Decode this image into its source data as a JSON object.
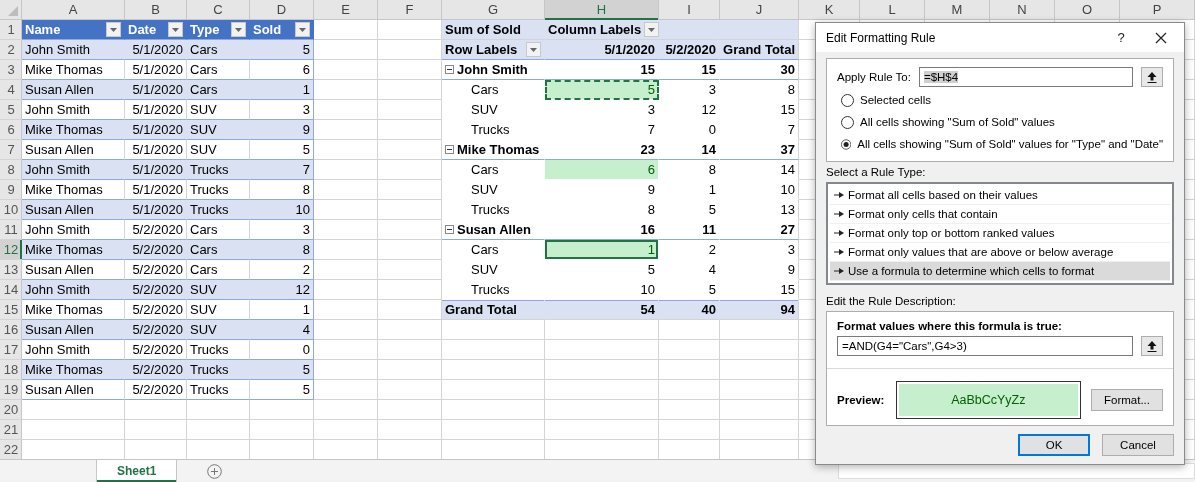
{
  "column_headers": [
    {
      "label": "A",
      "selected": false
    },
    {
      "label": "B",
      "selected": false
    },
    {
      "label": "C",
      "selected": false
    },
    {
      "label": "D",
      "selected": false
    },
    {
      "label": "E",
      "selected": false
    },
    {
      "label": "F",
      "selected": false
    },
    {
      "label": "G",
      "selected": false
    },
    {
      "label": "H",
      "selected": true
    },
    {
      "label": "I",
      "selected": false
    },
    {
      "label": "J",
      "selected": false
    },
    {
      "label": "K",
      "selected": false
    },
    {
      "label": "L",
      "selected": false
    },
    {
      "label": "M",
      "selected": false
    },
    {
      "label": "N",
      "selected": false
    },
    {
      "label": "O",
      "selected": false
    },
    {
      "label": "P",
      "selected": false
    }
  ],
  "row_headers": [
    {
      "label": "1",
      "selected": false
    },
    {
      "label": "2",
      "selected": false
    },
    {
      "label": "3",
      "selected": false
    },
    {
      "label": "4",
      "selected": false
    },
    {
      "label": "5",
      "selected": false
    },
    {
      "label": "6",
      "selected": false
    },
    {
      "label": "7",
      "selected": false
    },
    {
      "label": "8",
      "selected": false
    },
    {
      "label": "9",
      "selected": false
    },
    {
      "label": "10",
      "selected": false
    },
    {
      "label": "11",
      "selected": false
    },
    {
      "label": "12",
      "selected": true
    },
    {
      "label": "13",
      "selected": false
    },
    {
      "label": "14",
      "selected": false
    },
    {
      "label": "15",
      "selected": false
    },
    {
      "label": "16",
      "selected": false
    },
    {
      "label": "17",
      "selected": false
    },
    {
      "label": "18",
      "selected": false
    },
    {
      "label": "19",
      "selected": false
    },
    {
      "label": "20",
      "selected": false
    },
    {
      "label": "21",
      "selected": false
    },
    {
      "label": "22",
      "selected": false
    }
  ],
  "table": {
    "columns": [
      {
        "label": "Name"
      },
      {
        "label": "Date"
      },
      {
        "label": "Type"
      },
      {
        "label": "Sold"
      }
    ],
    "rows": [
      [
        "John Smith",
        "5/1/2020",
        "Cars",
        "5"
      ],
      [
        "Mike Thomas",
        "5/1/2020",
        "Cars",
        "6"
      ],
      [
        "Susan Allen",
        "5/1/2020",
        "Cars",
        "1"
      ],
      [
        "John Smith",
        "5/1/2020",
        "SUV",
        "3"
      ],
      [
        "Mike Thomas",
        "5/1/2020",
        "SUV",
        "9"
      ],
      [
        "Susan Allen",
        "5/1/2020",
        "SUV",
        "5"
      ],
      [
        "John Smith",
        "5/1/2020",
        "Trucks",
        "7"
      ],
      [
        "Mike Thomas",
        "5/1/2020",
        "Trucks",
        "8"
      ],
      [
        "Susan Allen",
        "5/1/2020",
        "Trucks",
        "10"
      ],
      [
        "John Smith",
        "5/2/2020",
        "Cars",
        "3"
      ],
      [
        "Mike Thomas",
        "5/2/2020",
        "Cars",
        "8"
      ],
      [
        "Susan Allen",
        "5/2/2020",
        "Cars",
        "2"
      ],
      [
        "John Smith",
        "5/2/2020",
        "SUV",
        "12"
      ],
      [
        "Mike Thomas",
        "5/2/2020",
        "SUV",
        "1"
      ],
      [
        "Susan Allen",
        "5/2/2020",
        "SUV",
        "4"
      ],
      [
        "John Smith",
        "5/2/2020",
        "Trucks",
        "0"
      ],
      [
        "Mike Thomas",
        "5/2/2020",
        "Trucks",
        "5"
      ],
      [
        "Susan Allen",
        "5/2/2020",
        "Trucks",
        "5"
      ]
    ]
  },
  "pivot": {
    "corner": "Sum of Sold",
    "column_field": "Column Labels",
    "row_field": "Row Labels",
    "columns": [
      "5/1/2020",
      "5/2/2020",
      "Grand Total"
    ],
    "groups": [
      {
        "label": "John Smith",
        "expanded": true,
        "values": [
          "15",
          "15",
          "30"
        ],
        "children": [
          {
            "label": "Cars",
            "values": [
              "5",
              "3",
              "8"
            ],
            "highlight": true,
            "copied": true,
            "selected": false
          },
          {
            "label": "SUV",
            "values": [
              "3",
              "12",
              "15"
            ],
            "highlight": false,
            "copied": false,
            "selected": false
          },
          {
            "label": "Trucks",
            "values": [
              "7",
              "0",
              "7"
            ],
            "highlight": false,
            "copied": false,
            "selected": false
          }
        ]
      },
      {
        "label": "Mike Thomas",
        "expanded": true,
        "values": [
          "23",
          "14",
          "37"
        ],
        "children": [
          {
            "label": "Cars",
            "values": [
              "6",
              "8",
              "14"
            ],
            "highlight": true,
            "copied": false,
            "selected": false
          },
          {
            "label": "SUV",
            "values": [
              "9",
              "1",
              "10"
            ],
            "highlight": false,
            "copied": false,
            "selected": false
          },
          {
            "label": "Trucks",
            "values": [
              "8",
              "5",
              "13"
            ],
            "highlight": false,
            "copied": false,
            "selected": false
          }
        ]
      },
      {
        "label": "Susan Allen",
        "expanded": true,
        "values": [
          "16",
          "11",
          "27"
        ],
        "children": [
          {
            "label": "Cars",
            "values": [
              "1",
              "2",
              "3"
            ],
            "highlight": true,
            "copied": false,
            "selected": true
          },
          {
            "label": "SUV",
            "values": [
              "5",
              "4",
              "9"
            ],
            "highlight": false,
            "copied": false,
            "selected": false
          },
          {
            "label": "Trucks",
            "values": [
              "10",
              "5",
              "15"
            ],
            "highlight": false,
            "copied": false,
            "selected": false
          }
        ]
      }
    ],
    "grand_total": {
      "label": "Grand Total",
      "values": [
        "54",
        "40",
        "94"
      ]
    }
  },
  "sheet_tabs": [
    {
      "label": "Sheet1",
      "selected": true
    }
  ],
  "dialog": {
    "title": "Edit Formatting Rule",
    "help": "?",
    "apply_label": "Apply Rule To:",
    "apply_value": "=$H$4",
    "scope_options": [
      {
        "label": "Selected cells",
        "selected": false
      },
      {
        "label": "All cells showing \"Sum of Sold\" values",
        "selected": false
      },
      {
        "label": "All cells showing \"Sum of Sold\" values for \"Type\" and \"Date\"",
        "selected": true
      }
    ],
    "rule_type_label": "Select a Rule Type:",
    "rule_types": [
      {
        "label": "Format all cells based on their values",
        "selected": false
      },
      {
        "label": "Format only cells that contain",
        "selected": false
      },
      {
        "label": "Format only top or bottom ranked values",
        "selected": false
      },
      {
        "label": "Format only values that are above or below average",
        "selected": false
      },
      {
        "label": "Use a formula to determine which cells to format",
        "selected": true
      }
    ],
    "description_label": "Edit the Rule Description:",
    "formula_label": "Format values where this formula is true:",
    "formula": "=AND(G4=\"Cars\",G4>3)",
    "preview_label": "Preview:",
    "preview_text": "AaBbCcYyZz",
    "format_button": "Format...",
    "buttons": [
      {
        "label": "OK",
        "default": true
      },
      {
        "label": "Cancel",
        "default": false
      }
    ]
  }
}
